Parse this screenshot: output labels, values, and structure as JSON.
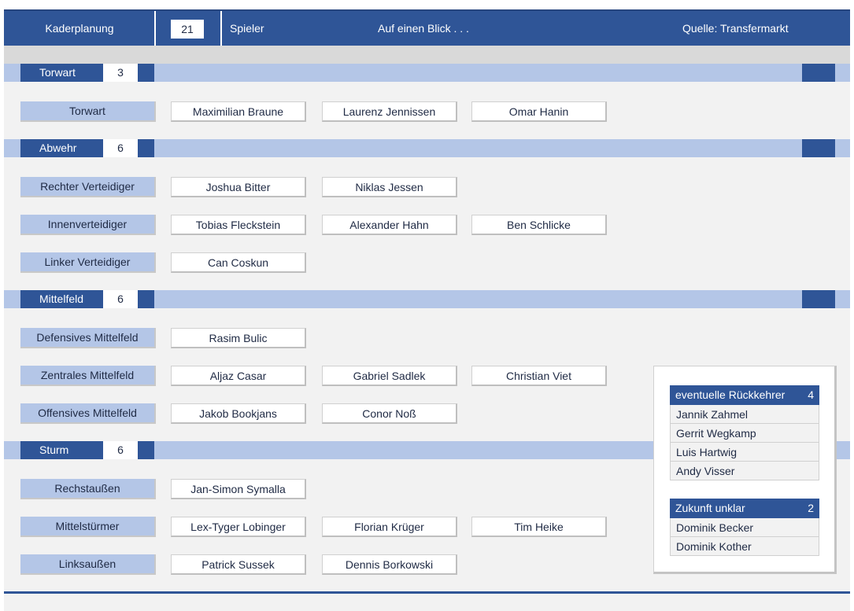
{
  "header": {
    "title": "Kaderplanung",
    "player_count": "21",
    "players_label": "Spieler",
    "glance": "Auf einen Blick . . .",
    "source": "Quelle: Transfermarkt"
  },
  "sections": [
    {
      "name": "Torwart",
      "count": "3",
      "positions": [
        {
          "label": "Torwart",
          "players": [
            "Maximilian Braune",
            "Laurenz Jennissen",
            "Omar Hanin"
          ]
        }
      ]
    },
    {
      "name": "Abwehr",
      "count": "6",
      "positions": [
        {
          "label": "Rechter Verteidiger",
          "players": [
            "Joshua Bitter",
            "Niklas Jessen"
          ]
        },
        {
          "label": "Innenverteidiger",
          "players": [
            "Tobias Fleckstein",
            "Alexander Hahn",
            "Ben Schlicke"
          ]
        },
        {
          "label": "Linker Verteidiger",
          "players": [
            "Can Coskun"
          ]
        }
      ]
    },
    {
      "name": "Mittelfeld",
      "count": "6",
      "positions": [
        {
          "label": "Defensives Mittelfeld",
          "players": [
            "Rasim Bulic"
          ]
        },
        {
          "label": "Zentrales Mittelfeld",
          "players": [
            "Aljaz Casar",
            "Gabriel Sadlek",
            "Christian Viet"
          ]
        },
        {
          "label": "Offensives Mittelfeld",
          "players": [
            "Jakob Bookjans",
            "Conor Noß"
          ]
        }
      ]
    },
    {
      "name": "Sturm",
      "count": "6",
      "positions": [
        {
          "label": "Rechstaußen",
          "players": [
            "Jan-Simon Symalla"
          ]
        },
        {
          "label": "Mittelstürmer",
          "players": [
            "Lex-Tyger Lobinger",
            "Florian Krüger",
            "Tim Heike"
          ]
        },
        {
          "label": "Linksaußen",
          "players": [
            "Patrick Sussek",
            "Dennis Borkowski"
          ]
        }
      ]
    }
  ],
  "side_panel": {
    "returners": {
      "title": "eventuelle Rückkehrer",
      "count": "4",
      "items": [
        "Jannik Zahmel",
        "Gerrit Wegkamp",
        "Luis Hartwig",
        "Andy Visser"
      ]
    },
    "unclear": {
      "title": "Zukunft unklar",
      "count": "2",
      "items": [
        "Dominik Becker",
        "Dominik Kother"
      ]
    }
  },
  "colors": {
    "accent": "#2f5597",
    "light_accent": "#b4c6e7",
    "background": "#f2f2f2"
  }
}
